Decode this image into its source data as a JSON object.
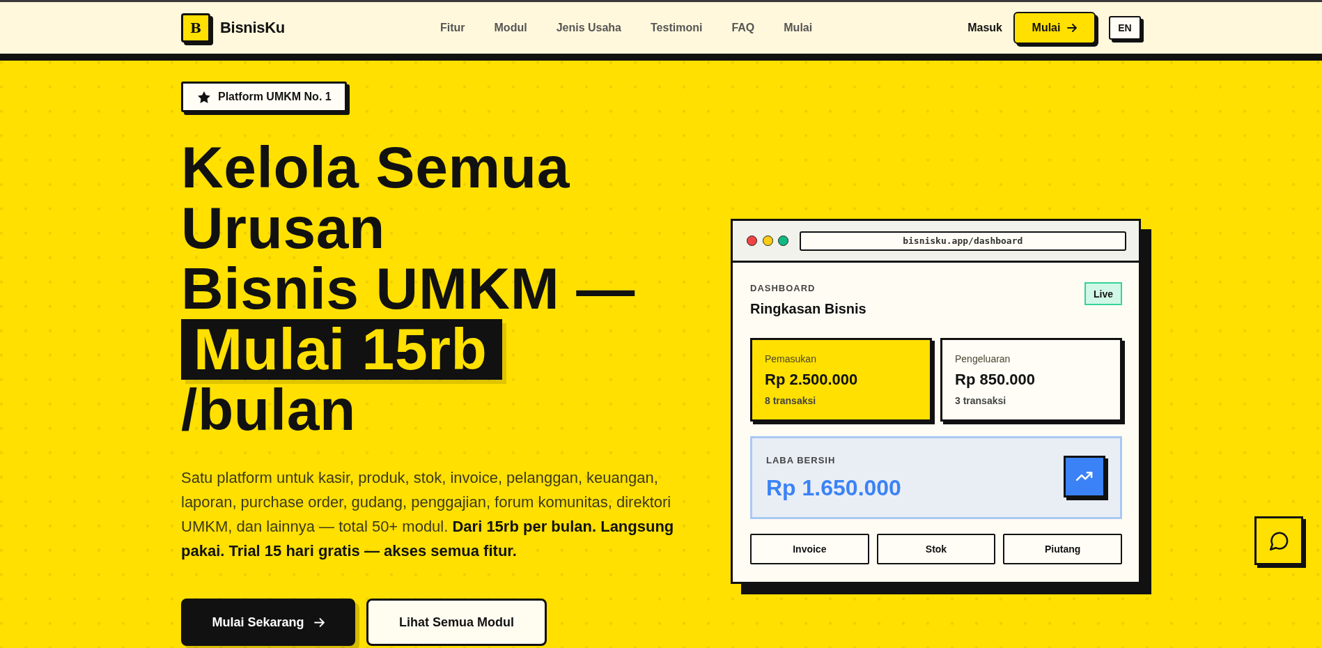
{
  "nav": {
    "logo_mark": "B",
    "brand": "BisnisKu",
    "links": [
      "Fitur",
      "Modul",
      "Jenis Usaha",
      "Testimoni",
      "FAQ",
      "Mulai"
    ],
    "login": "Masuk",
    "cta": "Mulai",
    "language": "EN"
  },
  "hero": {
    "badge": "Platform UMKM No. 1",
    "headline": {
      "lines": [
        "Kelola Semua Urusan",
        "Bisnis UMKM —"
      ],
      "highlight": "Mulai 15rb",
      "suffix": "/bulan"
    },
    "description": "Satu platform untuk kasir, produk, stok, invoice, pelanggan, keuangan, laporan, purchase order, gudang, penggajian, forum komunitas, direktori UMKM, dan lainnya — total 50+ modul. **Dari 15rb per bulan. Langsung pakai. Trial 15 hari gratis — akses semua fitur.**",
    "buttons": [
      {
        "label": "Mulai Sekarang",
        "kind": "primary"
      },
      {
        "label": "Lihat Semua Modul",
        "kind": "secondary"
      }
    ]
  },
  "preview": {
    "url": "bisnisku.app/dashboard",
    "eyebrow": "DASHBOARD",
    "title": "Ringkasan Bisnis",
    "status": "Live",
    "stats": [
      {
        "label": "Pemasukan",
        "value": "Rp 2.500.000",
        "note": "8 transaksi",
        "kind": "highlight"
      },
      {
        "label": "Pengeluaran",
        "value": "Rp 850.000",
        "note": "3 transaksi",
        "kind": "plain"
      }
    ],
    "profit": {
      "label": "LABA BERSIH",
      "value": "Rp 1.650.000"
    },
    "shortcuts": [
      "Invoice",
      "Stok",
      "Piutang"
    ]
  }
}
